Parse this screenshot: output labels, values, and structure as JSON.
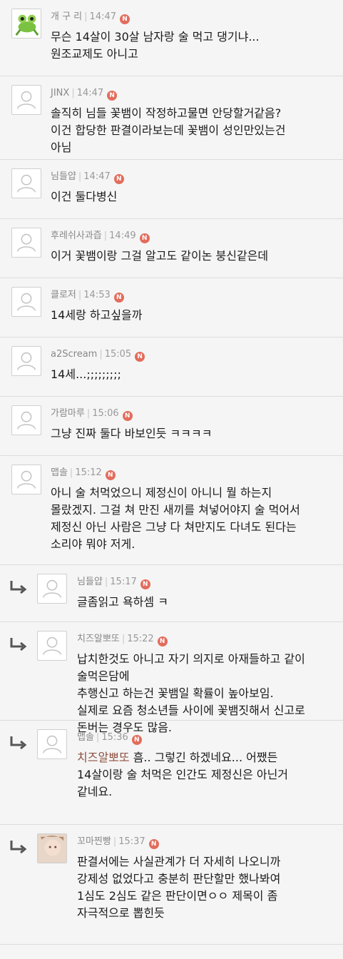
{
  "new_badge": "N",
  "comments": [
    {
      "nick": "개 구 리",
      "time": "14:47",
      "avatar": "frog-avatar",
      "reply": false,
      "text": "무슨 14살이 30살 남자랑 술 먹고 댕기냐...\n원조교제도 아니고"
    },
    {
      "nick": "JINX",
      "time": "14:47",
      "avatar": "default-user-icon",
      "reply": false,
      "text": "솔직히 님들 꽃뱀이 작정하고물면 안당할거같음?\n이건 합당한 판결이라보는데 꽃뱀이 성인만있는건\n아님"
    },
    {
      "nick": "님들얍",
      "time": "14:47",
      "avatar": "default-user-icon",
      "reply": false,
      "text": "이건 둘다병신"
    },
    {
      "nick": "후레쉬사과즙",
      "time": "14:49",
      "avatar": "default-user-icon",
      "reply": false,
      "text": "이거 꽃뱀이랑 그걸 알고도 같이논 붕신같은데"
    },
    {
      "nick": "클로저",
      "time": "14:53",
      "avatar": "default-user-icon",
      "reply": false,
      "text": "14세랑 하고싶을까"
    },
    {
      "nick": "a2Scream",
      "time": "15:05",
      "avatar": "default-user-icon",
      "reply": false,
      "text": "14세...;;;;;;;;;"
    },
    {
      "nick": "가람마루",
      "time": "15:06",
      "avatar": "default-user-icon",
      "reply": false,
      "text": "그냥 진짜 둘다 바보인듯 ㅋㅋㅋㅋ"
    },
    {
      "nick": "맵솔",
      "time": "15:12",
      "avatar": "default-user-icon",
      "reply": false,
      "text": "아니 술 처먹었으니 제정신이 아니니 뭘 하는지\n몰랐겠지. 그걸 쳐 만진 새끼를 쳐넣어야지 술 먹어서\n제정신 아닌 사람은 그냥 다 쳐만지도 다녀도 된다는\n소리야 뭐야 저게."
    },
    {
      "nick": "님들얍",
      "time": "15:17",
      "avatar": "default-user-icon",
      "reply": true,
      "text": "글좀읽고 욕하셈 ㅋ"
    },
    {
      "nick": "치즈알뽀또",
      "time": "15:22",
      "avatar": "default-user-icon",
      "reply": true,
      "text": "납치한것도 아니고 자기 의지로 아재들하고 같이\n술먹은담에\n추행신고 하는건 꽃뱀일 확률이 높아보임.\n실제로 요즘 청소년들 사이에 꽃뱀짓해서 신고로\n돈버는 경우도 많음."
    },
    {
      "nick": "맵솔",
      "time": "15:36",
      "avatar": "default-user-icon",
      "reply": true,
      "mention": "치즈알뽀또",
      "text": " 흠.. 그렇긴 하겠네요... 어쨌든\n14살이랑 술 처먹은 인간도 제정신은 아닌거\n같네요."
    },
    {
      "nick": "꼬마찐빵",
      "time": "15:37",
      "avatar": "photo-avatar",
      "reply": true,
      "text": "판결서에는 사실관계가 더 자세히 나오니까\n강제성 없었다고 충분히 판단할만 했나봐여\n1심도 2심도 같은 판단이면ㅇㅇ 제목이 좀\n자극적으로 뽑힌듯"
    }
  ]
}
